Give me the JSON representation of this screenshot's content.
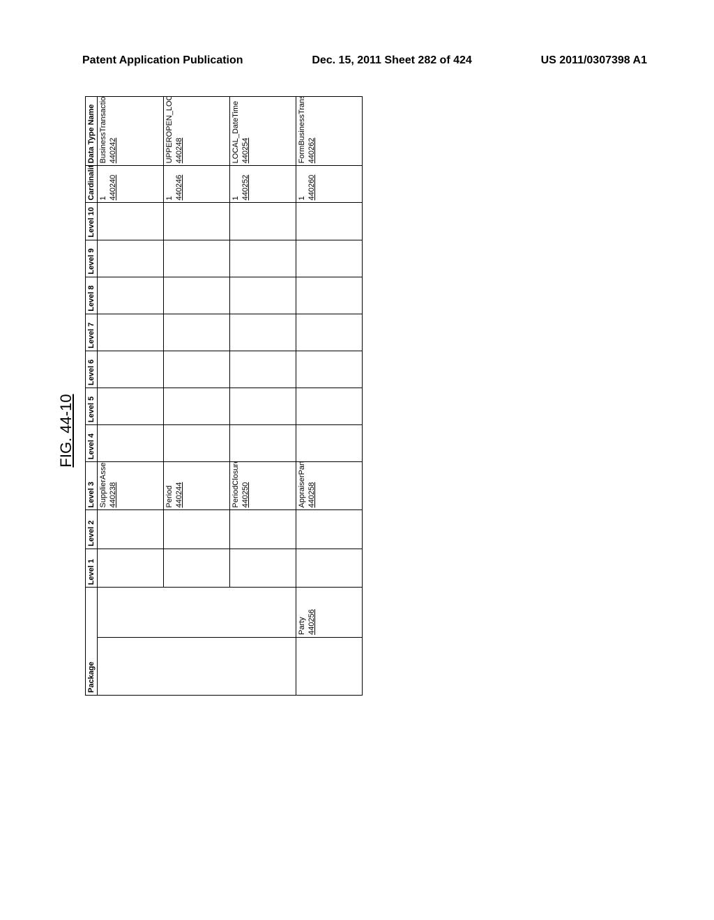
{
  "header": {
    "left": "Patent Application Publication",
    "center": "Dec. 15, 2011  Sheet 282 of 424",
    "right": "US 2011/0307398 A1"
  },
  "figure_label": "FIG. 44-10",
  "columns": {
    "package": "Package",
    "l1": "Level 1",
    "l2": "Level 2",
    "l3": "Level 3",
    "l4": "Level 4",
    "l5": "Level 5",
    "l6": "Level 6",
    "l7": "Level 7",
    "l8": "Level 8",
    "l9": "Level 9",
    "l10": "Level 10",
    "cardinality": "Cardinality",
    "datatype": "Data Type Name"
  },
  "rows": [
    {
      "l3": "SupplierAssessmentProfileID",
      "l3_ref": "440238",
      "card": "1",
      "card_ref": "440240",
      "dt": "BusinessTransactionDocumentID",
      "dt_ref": "440242"
    },
    {
      "l3": "Period",
      "l3_ref": "440244",
      "card": "1",
      "card_ref": "440246",
      "dt": "UPPEROPEN_LOCAL_DateTimePeriod",
      "dt_ref": "440248"
    },
    {
      "l3": "PeriodClosureDateTime",
      "l3_ref": "440250",
      "card": "1",
      "card_ref": "440252",
      "dt": "LOCAL_DateTime",
      "dt_ref": "440254"
    },
    {
      "pkg_sub": "Party",
      "pkg_sub_ref": "440256",
      "l3": "AppraiserParty",
      "l3_ref": "440258",
      "card": "1",
      "card_ref": "440260",
      "dt": "FormBusinessTransactionDocumentParty",
      "dt_ref": "440262"
    }
  ]
}
